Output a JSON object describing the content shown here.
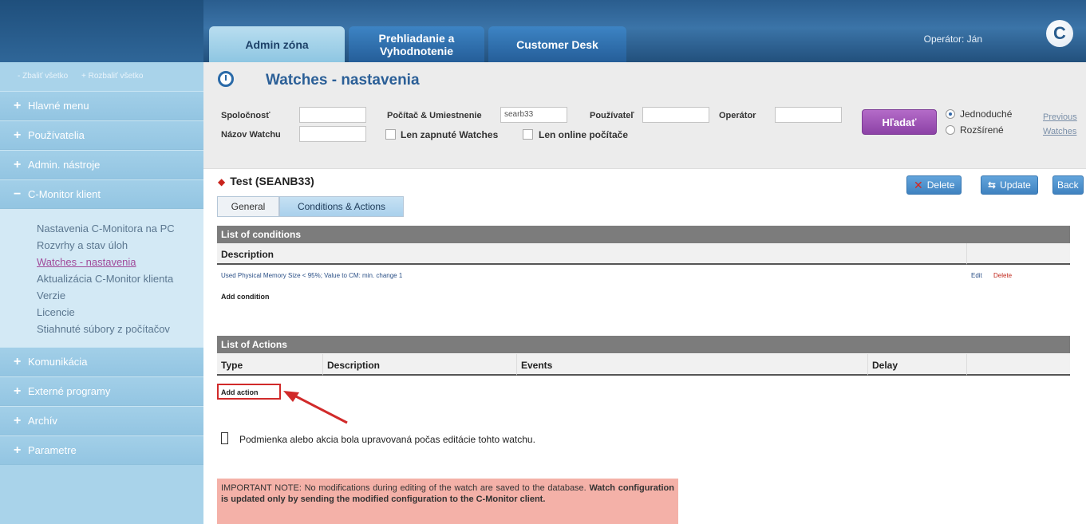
{
  "header": {
    "tabs": [
      {
        "label": "Admin zóna",
        "active": true
      },
      {
        "label": "Prehliadanie a Vyhodnotenie",
        "active": false
      },
      {
        "label": "Customer Desk",
        "active": false
      }
    ],
    "operator_label": "Operátor: Ján",
    "logo_letter": "C"
  },
  "sidebar": {
    "collapse_all": "- Zbaliť všetko",
    "expand_all": "+ Rozbaliť všetko",
    "items": [
      {
        "sign": "+",
        "label": "Hlavné menu"
      },
      {
        "sign": "+",
        "label": "Používatelia"
      },
      {
        "sign": "+",
        "label": "Admin. nástroje"
      },
      {
        "sign": "−",
        "label": "C-Monitor klient"
      },
      {
        "sign": "+",
        "label": "Komunikácia"
      },
      {
        "sign": "+",
        "label": "Externé programy"
      },
      {
        "sign": "+",
        "label": "Archív"
      },
      {
        "sign": "+",
        "label": "Parametre"
      }
    ],
    "submenu": [
      "Nastavenia C-Monitora na PC",
      "Rozvrhy a stav úloh",
      "Watches - nastavenia",
      "Aktualizácia C-Monitor klienta",
      "Verzie",
      "Licencie",
      "Stiahnuté súbory z počítačov"
    ]
  },
  "page": {
    "title": "Watches - nastavenia",
    "clock_icon": "clock-icon"
  },
  "filters": {
    "company_label": "Spoločnosť",
    "company_value": "",
    "computer_label": "Počítač & Umiestnenie",
    "computer_value": "searb33",
    "user_label": "Používateľ",
    "user_value": "",
    "operator_label": "Operátor",
    "operator_value": "",
    "watch_name_label": "Názov Watchu",
    "watch_name_value": "",
    "only_enabled_label": "Len zapnuté Watches",
    "only_online_label": "Len online počítače",
    "search_button": "Hľadať",
    "mode_simple": "Jednoduché",
    "mode_advanced": "Rozšírené",
    "prev_link_1": "Previous",
    "prev_link_2": "Watches"
  },
  "record": {
    "title": "Test (SEANB33)",
    "delete_button": "Delete",
    "update_button": "Update",
    "back_button": "Back",
    "tab_general": "General",
    "tab_conditions": "Conditions & Actions"
  },
  "conditions": {
    "section_title": "List of conditions",
    "col_description": "Description",
    "rows": [
      {
        "description": "Used Physical Memory Size < 95%; Value to CM: min. change 1",
        "edit": "Edit",
        "delete": "Delete"
      }
    ],
    "add_label": "Add condition"
  },
  "actions": {
    "section_title": "List of Actions",
    "col_type": "Type",
    "col_description": "Description",
    "col_events": "Events",
    "col_delay": "Delay",
    "add_label": "Add action"
  },
  "legend_text": "Podmienka alebo akcia bola upravovaná počas editácie tohto watchu.",
  "note": {
    "part1": "IMPORTANT NOTE: No modifications during editing of the watch are saved to the database.",
    "part2": "Watch configuration is updated only by sending the modified configuration to the C-Monitor client."
  },
  "colors": {
    "accent": "#2b5f97",
    "search_button": "#8c42a6",
    "note_bg": "#f4b1a8",
    "annotation": "#d12a2a"
  }
}
